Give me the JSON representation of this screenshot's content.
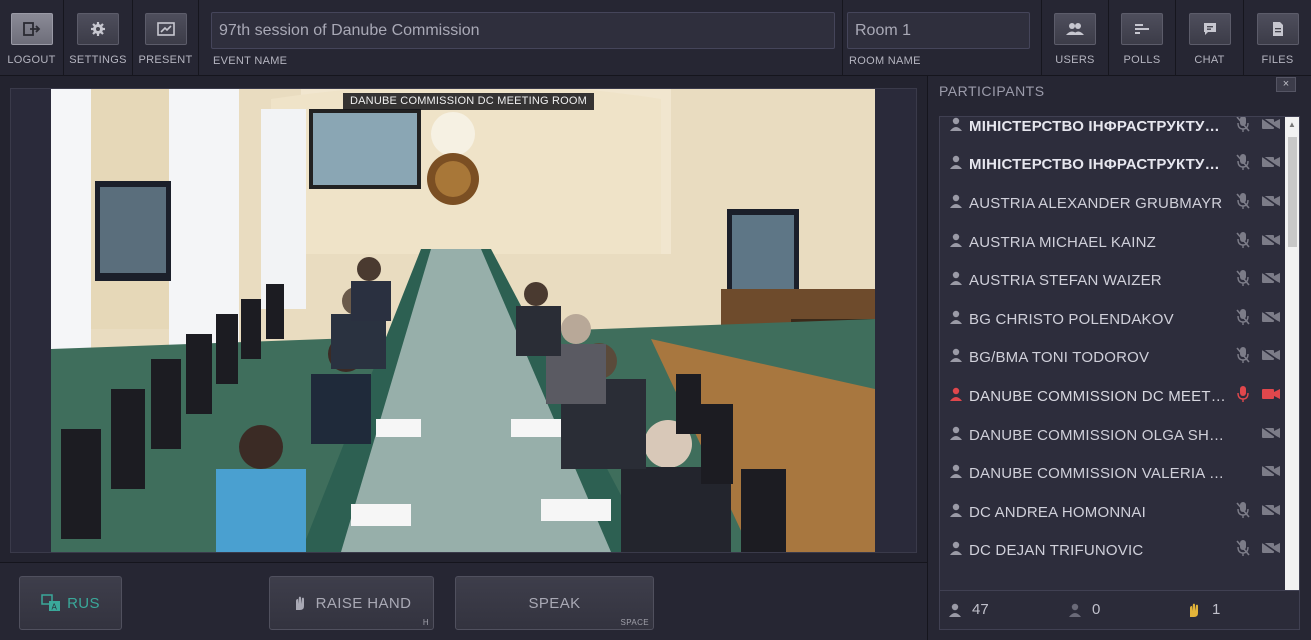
{
  "toolbar": {
    "logout": "LOGOUT",
    "settings": "SETTINGS",
    "present": "PRESENT",
    "event_name_label": "EVENT NAME",
    "event_name_value": "97th session of Danube Commission",
    "room_name_label": "ROOM NAME",
    "room_name_value": "Room 1",
    "users": "USERS",
    "polls": "POLLS",
    "chat": "CHAT",
    "files": "FILES"
  },
  "video": {
    "caption": "DANUBE COMMISSION DC MEETING ROOM"
  },
  "controls": {
    "language": "RUS",
    "raise_hand": "RAISE HAND",
    "raise_hand_hint": "H",
    "speak": "SPEAK",
    "speak_hint": "SPACE"
  },
  "participants": {
    "title": "PARTICIPANTS",
    "close": "×",
    "items": [
      {
        "name": "МІНІСТЕРСТВО ІНФРАСТРУКТУРИ...",
        "mic": "muted",
        "cam": "off",
        "style": "bold"
      },
      {
        "name": "МІНІСТЕРСТВО ІНФРАСТРУКТУРИ...",
        "mic": "muted",
        "cam": "off",
        "style": "bold"
      },
      {
        "name": "AUSTRIA ALEXANDER GRUBMAYR",
        "mic": "muted",
        "cam": "off",
        "style": "normal"
      },
      {
        "name": "AUSTRIA MICHAEL KAINZ",
        "mic": "muted",
        "cam": "off",
        "style": "normal"
      },
      {
        "name": "AUSTRIA STEFAN WAIZER",
        "mic": "muted",
        "cam": "off",
        "style": "normal"
      },
      {
        "name": "BG CHRISTO POLENDAKOV",
        "mic": "muted",
        "cam": "off",
        "style": "normal"
      },
      {
        "name": "BG/BMA TONI TODOROV",
        "mic": "muted",
        "cam": "off",
        "style": "normal"
      },
      {
        "name": "DANUBE COMMISSION DC MEETIN...",
        "mic": "live",
        "cam": "live",
        "style": "red"
      },
      {
        "name": "DANUBE COMMISSION OLGA SHIR...",
        "mic": "none",
        "cam": "off",
        "style": "normal"
      },
      {
        "name": "DANUBE COMMISSION VALERIA B...",
        "mic": "none",
        "cam": "off",
        "style": "normal"
      },
      {
        "name": "DC ANDREA HOMONNAI",
        "mic": "muted",
        "cam": "off",
        "style": "normal"
      },
      {
        "name": "DC DEJAN TRIFUNOVIC",
        "mic": "muted",
        "cam": "off",
        "style": "normal"
      }
    ],
    "stats": {
      "total": "47",
      "guests": "0",
      "hands": "1"
    }
  },
  "colors": {
    "accent_red": "#e0474c",
    "accent_yellow": "#e3b43a",
    "accent_teal": "#3aa89a"
  }
}
